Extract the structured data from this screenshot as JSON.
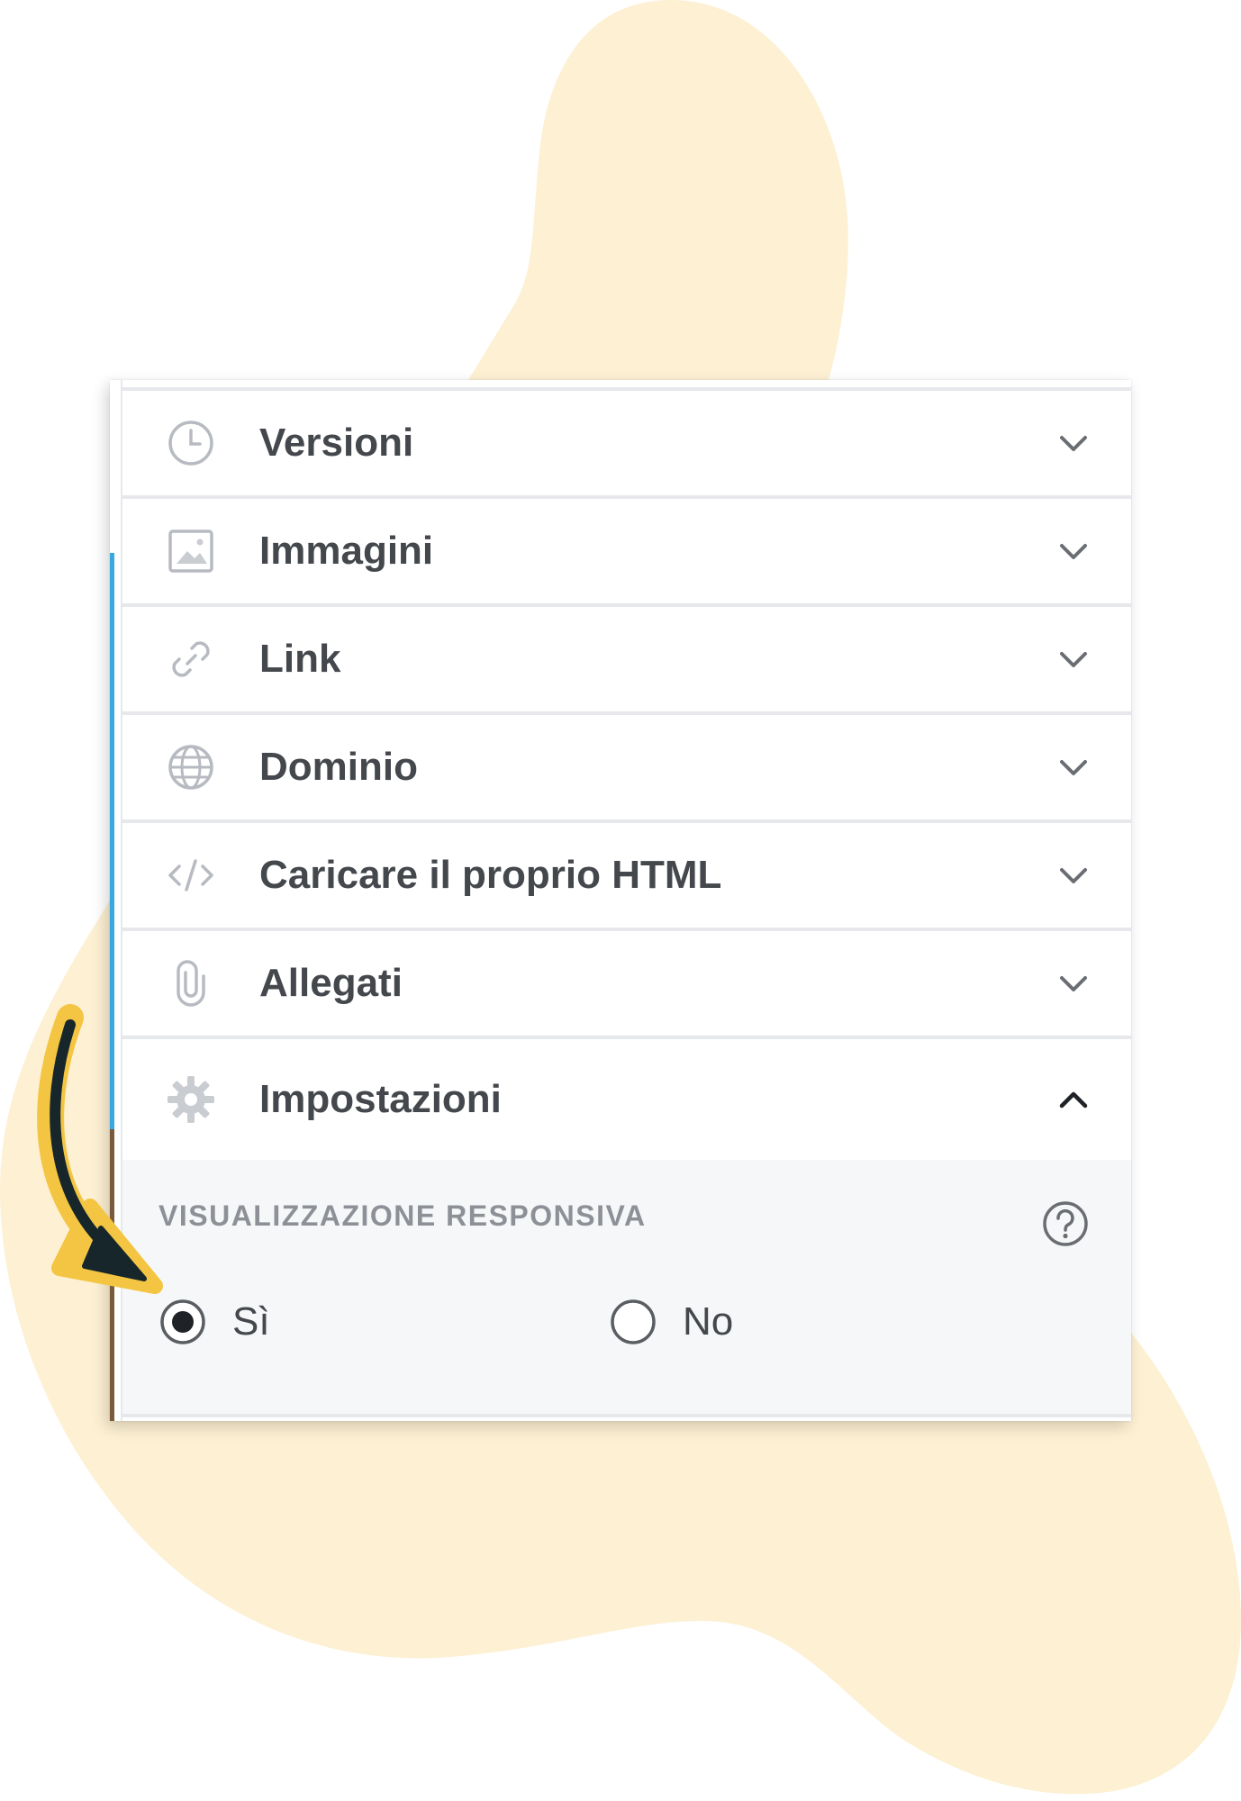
{
  "colors": {
    "background_blob": "#fdf0d3",
    "panel_background": "#ffffff",
    "settings_background": "#f6f7f9",
    "divider": "#e6e8eb",
    "label_text": "#44484d",
    "icon_gray": "#b7bbc1",
    "section_title": "#8d9197",
    "arrow_fill": "#f4c542",
    "arrow_outline": "#16262a",
    "accent_blue": "#3aa8e0"
  },
  "panel": {
    "items": [
      {
        "label": "Versioni",
        "icon": "clock-icon",
        "expanded": false
      },
      {
        "label": "Immagini",
        "icon": "image-icon",
        "expanded": false
      },
      {
        "label": "Link",
        "icon": "link-icon",
        "expanded": false
      },
      {
        "label": "Dominio",
        "icon": "globe-icon",
        "expanded": false
      },
      {
        "label": "Caricare il proprio HTML",
        "icon": "code-icon",
        "expanded": false
      },
      {
        "label": "Allegati",
        "icon": "paperclip-icon",
        "expanded": false
      },
      {
        "label": "Impostazioni",
        "icon": "gear-icon",
        "expanded": true
      }
    ]
  },
  "settings": {
    "section_title": "VISUALIZZAZIONE RESPONSIVA",
    "help_icon": "question-circle-icon",
    "options": [
      {
        "label": "Sì",
        "selected": true
      },
      {
        "label": "No",
        "selected": false
      }
    ]
  },
  "annotation": {
    "arrow_icon": "curved-arrow-icon",
    "points_to": "Sì"
  }
}
